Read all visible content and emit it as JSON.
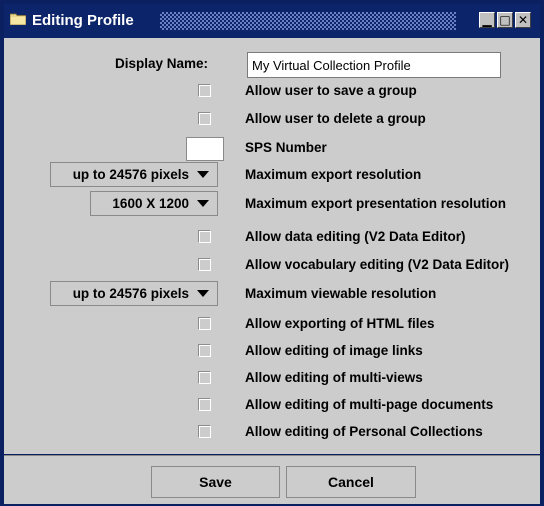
{
  "window": {
    "title": "Editing Profile",
    "controls": {
      "minimize": "▁",
      "maximize": "□",
      "close": "✕"
    }
  },
  "form": {
    "display_name_label": "Display Name:",
    "display_name_value": "My Virtual Collection Profile",
    "rows": [
      {
        "label": "Allow user to save a group",
        "checked": false
      },
      {
        "label": "Allow user to delete a group",
        "checked": false
      },
      {
        "label": "SPS Number",
        "value": ""
      },
      {
        "label": "Maximum export resolution",
        "selected": "up to 24576 pixels"
      },
      {
        "label": "Maximum export presentation resolution",
        "selected": "1600 X 1200"
      },
      {
        "label": "Allow data editing (V2 Data Editor)",
        "checked": false
      },
      {
        "label": "Allow vocabulary editing (V2 Data Editor)",
        "checked": false
      },
      {
        "label": "Maximum viewable resolution",
        "selected": "up to 24576 pixels"
      },
      {
        "label": "Allow exporting of HTML files",
        "checked": false
      },
      {
        "label": "Allow editing of image links",
        "checked": false
      },
      {
        "label": "Allow editing of multi-views",
        "checked": false
      },
      {
        "label": "Allow editing of multi-page documents",
        "checked": false
      },
      {
        "label": "Allow editing of Personal Collections",
        "checked": false
      }
    ]
  },
  "buttons": {
    "save": "Save",
    "cancel": "Cancel"
  },
  "colors": {
    "titlebar": "#0c2469",
    "panel": "#cccccc",
    "border": "#0a2060"
  },
  "icons": {
    "window_icon": "folder-icon"
  }
}
